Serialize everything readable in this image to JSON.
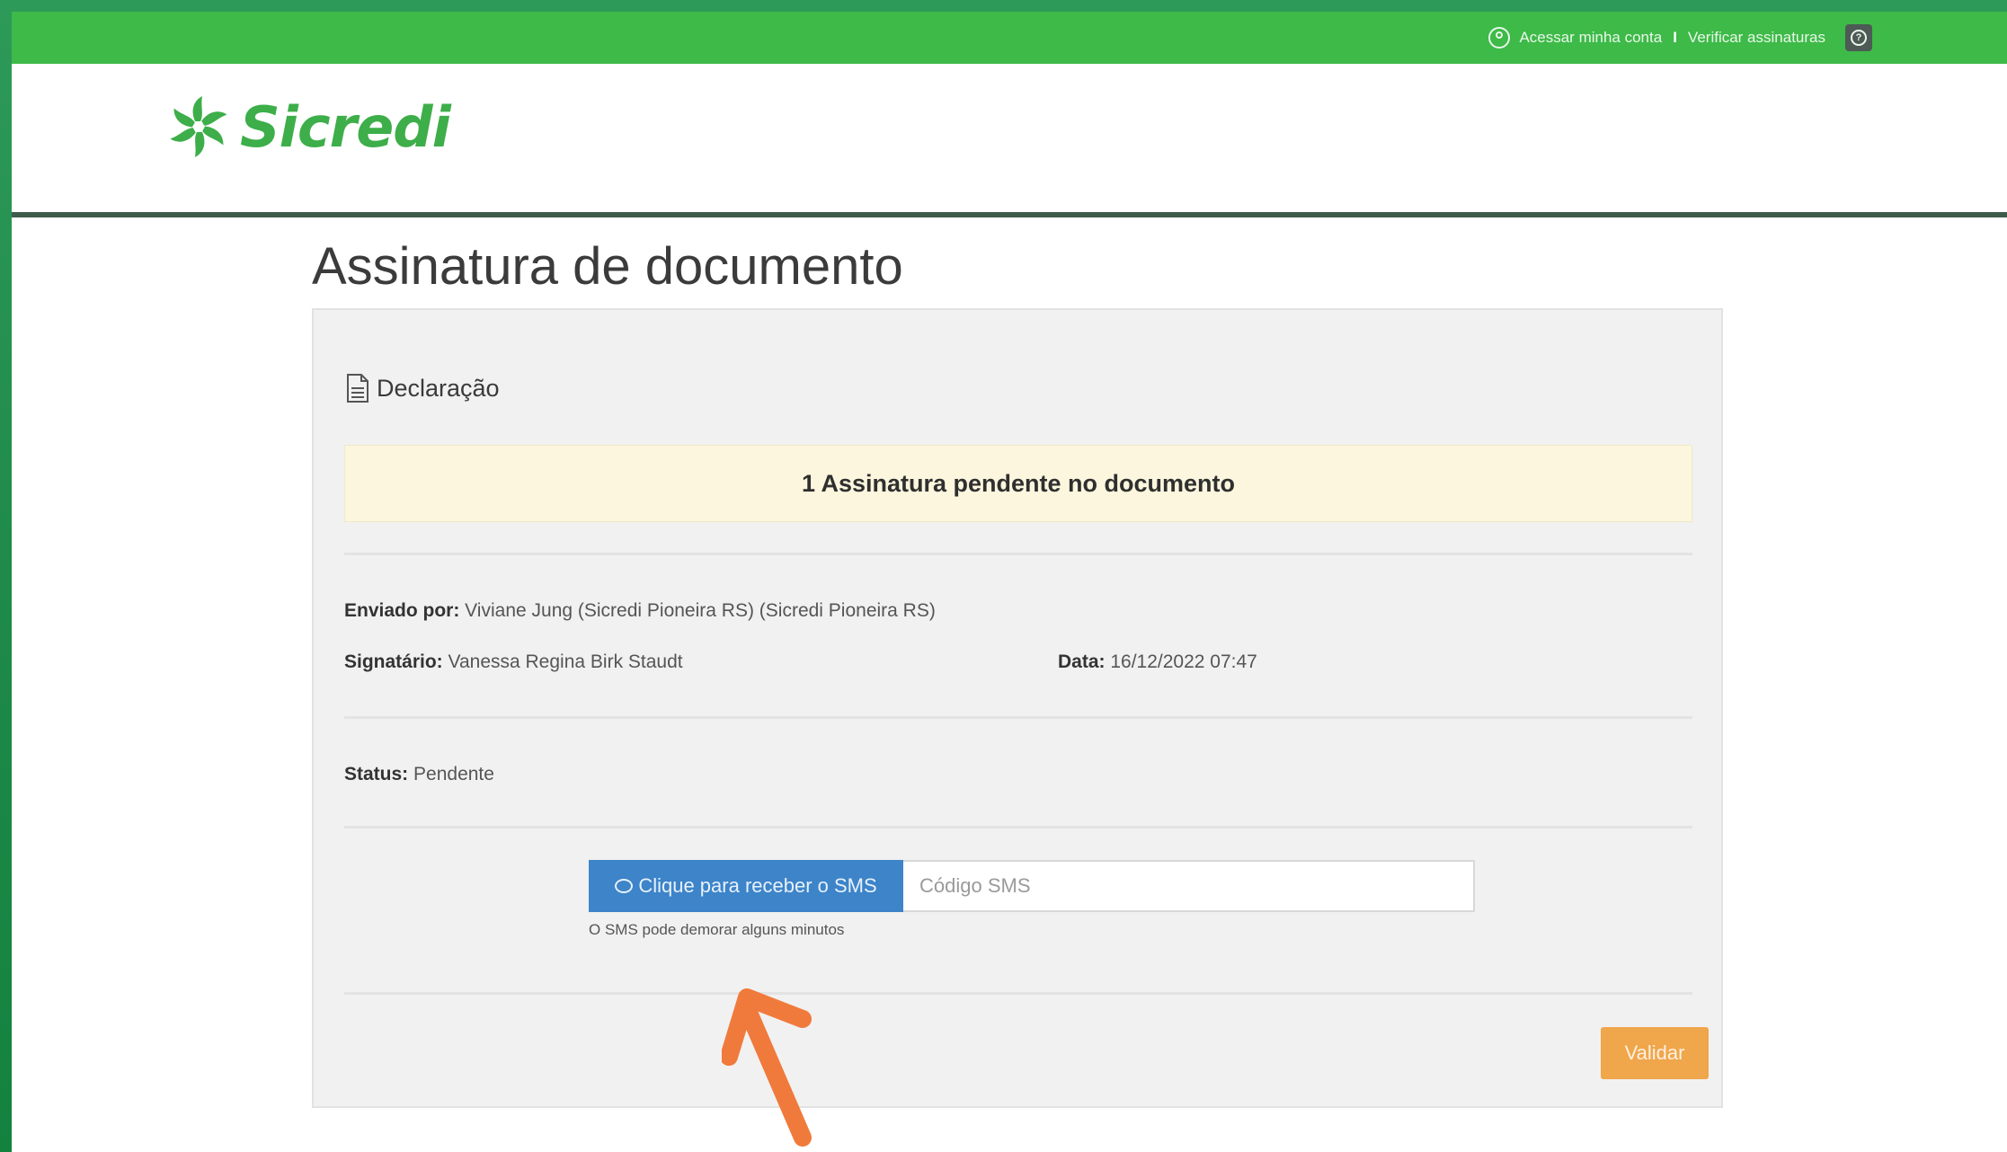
{
  "topbar": {
    "account_link": "Acessar minha conta",
    "separator": "I",
    "verify_link": "Verificar assinaturas"
  },
  "brand": {
    "name": "Sicredi",
    "color": "#3dae49"
  },
  "page": {
    "title": "Assinatura de documento"
  },
  "document": {
    "title": "Declaração",
    "alert": "1 Assinatura pendente no documento",
    "sent_by_label": "Enviado por:",
    "sent_by_value": " Viviane Jung (Sicredi Pioneira RS) (Sicredi Pioneira RS)",
    "signer_label": "Signatário:",
    "signer_value": " Vanessa Regina Birk Staudt",
    "date_label": "Data:",
    "date_value": " 16/12/2022 07:47",
    "status_label": "Status:",
    "status_value": " Pendente"
  },
  "sms": {
    "button_label": "Clique para receber o SMS",
    "input_placeholder": "Código SMS",
    "help_text": "O SMS pode demorar alguns minutos"
  },
  "actions": {
    "validate_label": "Validar"
  },
  "colors": {
    "topbar": "#3dba47",
    "primary_button": "#3d84c9",
    "validate_button": "#f0a64b",
    "arrow": "#f07a3c"
  },
  "icons": [
    "user-icon",
    "help-icon",
    "document-icon",
    "chat-icon",
    "arrow-annotation"
  ]
}
